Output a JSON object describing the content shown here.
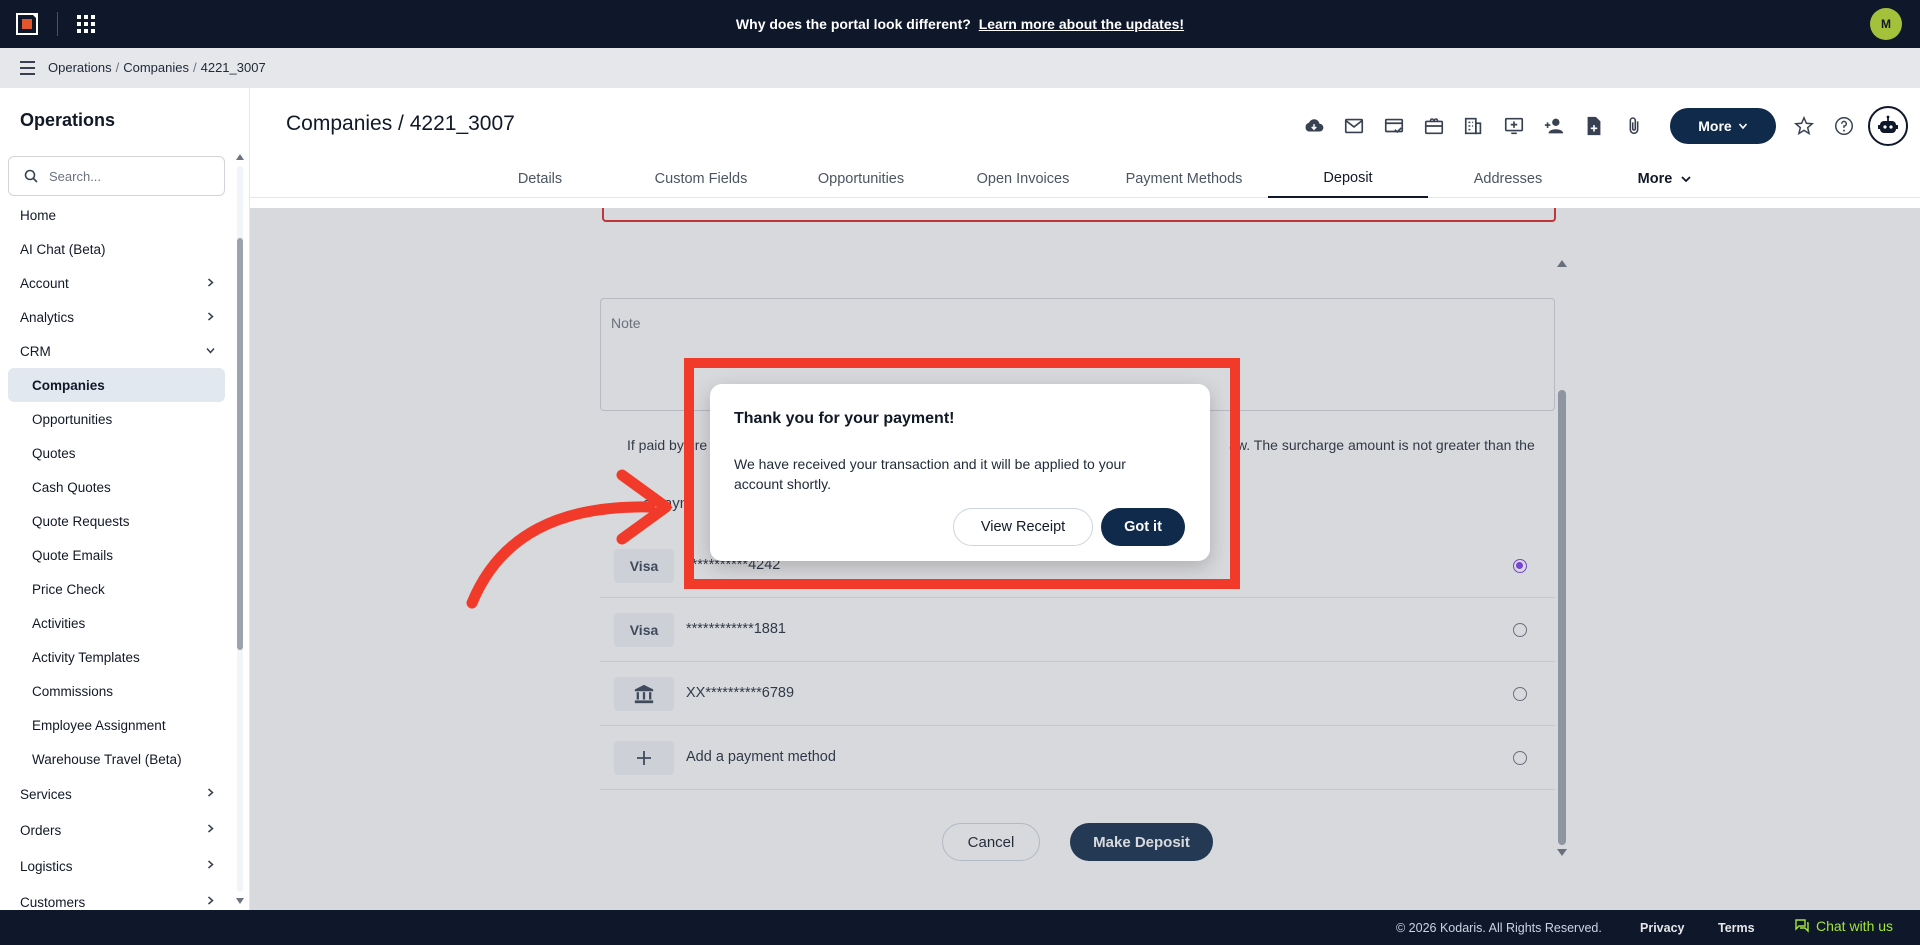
{
  "topbar": {
    "announce_text": "Why does the portal look different?",
    "announce_link": "Learn more about the updates!",
    "user_initial": "M"
  },
  "breadcrumb": [
    "Operations",
    "Companies",
    "4221_3007"
  ],
  "sidebar": {
    "title": "Operations",
    "search_placeholder": "Search...",
    "items": [
      {
        "label": "Home"
      },
      {
        "label": "AI Chat (Beta)"
      },
      {
        "label": "Account"
      },
      {
        "label": "Analytics"
      },
      {
        "label": "CRM"
      },
      {
        "label": "Companies"
      },
      {
        "label": "Opportunities"
      },
      {
        "label": "Quotes"
      },
      {
        "label": "Cash Quotes"
      },
      {
        "label": "Quote Requests"
      },
      {
        "label": "Quote Emails"
      },
      {
        "label": "Price Check"
      },
      {
        "label": "Activities"
      },
      {
        "label": "Activity Templates"
      },
      {
        "label": "Commissions"
      },
      {
        "label": "Employee Assignment"
      },
      {
        "label": "Warehouse Travel (Beta)"
      },
      {
        "label": "Services"
      },
      {
        "label": "Orders"
      },
      {
        "label": "Logistics"
      },
      {
        "label": "Customers"
      }
    ]
  },
  "header": {
    "title": "Companies / 4221_3007",
    "more_label": "More"
  },
  "tabs": [
    {
      "label": "Details"
    },
    {
      "label": "Custom Fields"
    },
    {
      "label": "Opportunities"
    },
    {
      "label": "Open Invoices"
    },
    {
      "label": "Payment Methods"
    },
    {
      "label": "Deposit"
    },
    {
      "label": "Addresses"
    },
    {
      "label": "More"
    }
  ],
  "form": {
    "note_placeholder": "Note",
    "surcharge_text_left": "If paid by cre",
    "surcharge_text_right": "aw. The surcharge amount is not greater than the",
    "payment_label": "a paym",
    "payment_methods": [
      {
        "badge": "Visa",
        "number": "***********4242",
        "selected": true
      },
      {
        "badge": "Visa",
        "number": "************1881",
        "selected": false
      },
      {
        "badge": "bank-icon",
        "number": "XX**********6789",
        "selected": false
      },
      {
        "badge": "plus-icon",
        "number": "Add a payment method",
        "selected": false
      }
    ],
    "cancel_label": "Cancel",
    "deposit_label": "Make Deposit"
  },
  "modal": {
    "title": "Thank you for your payment!",
    "body": "We have received your transaction and it will be applied to your account shortly.",
    "view_receipt_label": "View Receipt",
    "got_it_label": "Got it"
  },
  "footer": {
    "copyright": "© 2026 Kodaris. All Rights Reserved.",
    "privacy": "Privacy",
    "terms": "Terms",
    "chat": "Chat with us"
  },
  "colors": {
    "navy": "#0f172a",
    "primary_button": "#0f2a4a",
    "highlight": "#f23a2a",
    "chat_accent": "#a3e635"
  }
}
